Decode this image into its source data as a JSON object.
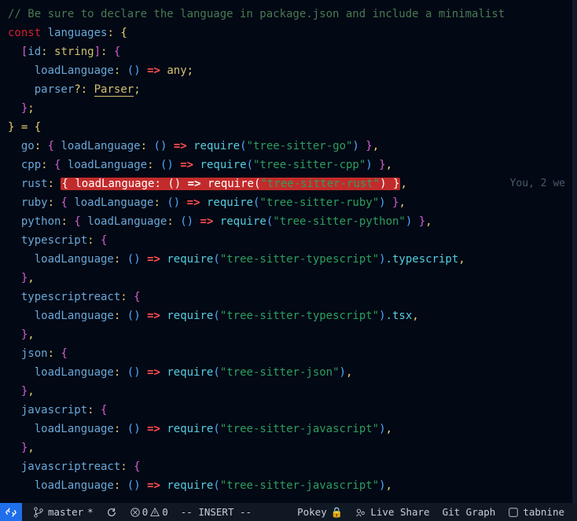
{
  "editor": {
    "comment": "// Be sure to declare the language in package.json and include a minimalist",
    "l_const": "const",
    "l_languages": "languages",
    "l_id": "id",
    "l_string": "string",
    "l_loadLanguage": "loadLanguage",
    "l_any": "any",
    "l_parser": "parser",
    "l_opt": "?",
    "l_Parser": "Parser",
    "l_require": "require",
    "langs": {
      "go": {
        "key": "go",
        "mod": "\"tree-sitter-go\""
      },
      "cpp": {
        "key": "cpp",
        "mod": "\"tree-sitter-cpp\""
      },
      "rust": {
        "key": "rust",
        "mod": "\"tree-sitter-rust\""
      },
      "ruby": {
        "key": "ruby",
        "mod": "\"tree-sitter-ruby\""
      },
      "python": {
        "key": "python",
        "mod": "\"tree-sitter-python\""
      }
    },
    "complex": {
      "typescript": {
        "key": "typescript",
        "mod": "\"tree-sitter-typescript\"",
        "suffix": ".typescript"
      },
      "typescriptreact": {
        "key": "typescriptreact",
        "mod": "\"tree-sitter-typescript\"",
        "suffix": ".tsx"
      },
      "json": {
        "key": "json",
        "mod": "\"tree-sitter-json\"",
        "suffix": ""
      },
      "javascript": {
        "key": "javascript",
        "mod": "\"tree-sitter-javascript\"",
        "suffix": ""
      },
      "javascriptreact": {
        "key": "javascriptreact",
        "mod": "\"tree-sitter-javascript\"",
        "suffix": ""
      }
    },
    "blame": "You, 2 we"
  },
  "status": {
    "remote_icon": "><",
    "branch": "master",
    "branch_dirty": "*",
    "sync_icon": "↻",
    "errors": "0",
    "warnings": "0",
    "vim_mode": "-- INSERT --",
    "live_share": "Live Share",
    "git_graph": "Git Graph",
    "tabnine": "tabnine",
    "user": "Pokey"
  }
}
